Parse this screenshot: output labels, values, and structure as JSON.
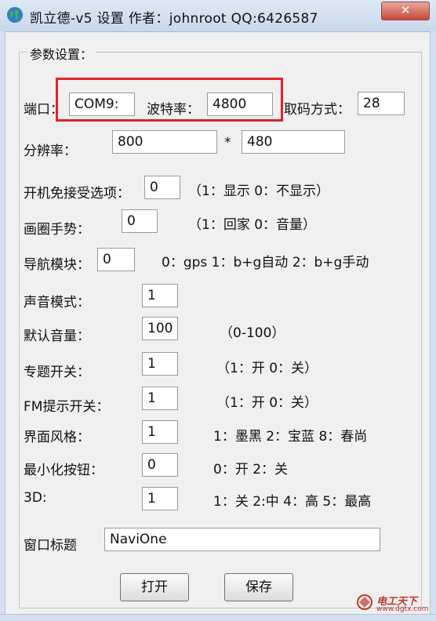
{
  "window": {
    "title": "凯立德-v5 设置  作者：johnroot  QQ:6426587",
    "close_label": "✕"
  },
  "group": {
    "title": "参数设置："
  },
  "port": {
    "label": "端口：",
    "value": "COM9:"
  },
  "baud": {
    "label": "波特率：",
    "value": "4800"
  },
  "fetch_mode": {
    "label": "取码方式：",
    "value": "28"
  },
  "resolution": {
    "label": "分辨率：",
    "width": "800",
    "separator": "*",
    "height": "480"
  },
  "boot_option": {
    "label": "开机免接受选项：",
    "value": "0",
    "hint": "（1：显示 0：不显示）"
  },
  "gesture": {
    "label": "画圈手势：",
    "value": "0",
    "hint": "（1：回家 0：音量）"
  },
  "nav_module": {
    "label": "导航模块：",
    "value": "0",
    "hint": "0：gps 1：b+g自动  2：b+g手动"
  },
  "sound_mode": {
    "label": "声音模式：",
    "value": "1"
  },
  "default_volume": {
    "label": "默认音量：",
    "value": "100",
    "hint": "（0-100）"
  },
  "topic_switch": {
    "label": "专题开关：",
    "value": "1",
    "hint": "（1：开 0：关）"
  },
  "fm_switch": {
    "label": "FM提示开关：",
    "value": "1",
    "hint": "（1：开 0：关）"
  },
  "ui_style": {
    "label": "界面风格：",
    "value": "1",
    "hint": "1：墨黑  2：宝蓝  8：春尚"
  },
  "minimize_btn": {
    "label": "最小化按钮：",
    "value": "0",
    "hint": "0：开 2：关"
  },
  "three_d": {
    "label": "3D:",
    "value": "1",
    "hint": "1：关  2:中  4：高  5：最高"
  },
  "window_title": {
    "label": "窗口标题",
    "value": "NaviOne"
  },
  "buttons": {
    "open": "打开",
    "save": "保存"
  },
  "watermark": {
    "text": "电工天下",
    "url": "www.dgtx.com"
  }
}
